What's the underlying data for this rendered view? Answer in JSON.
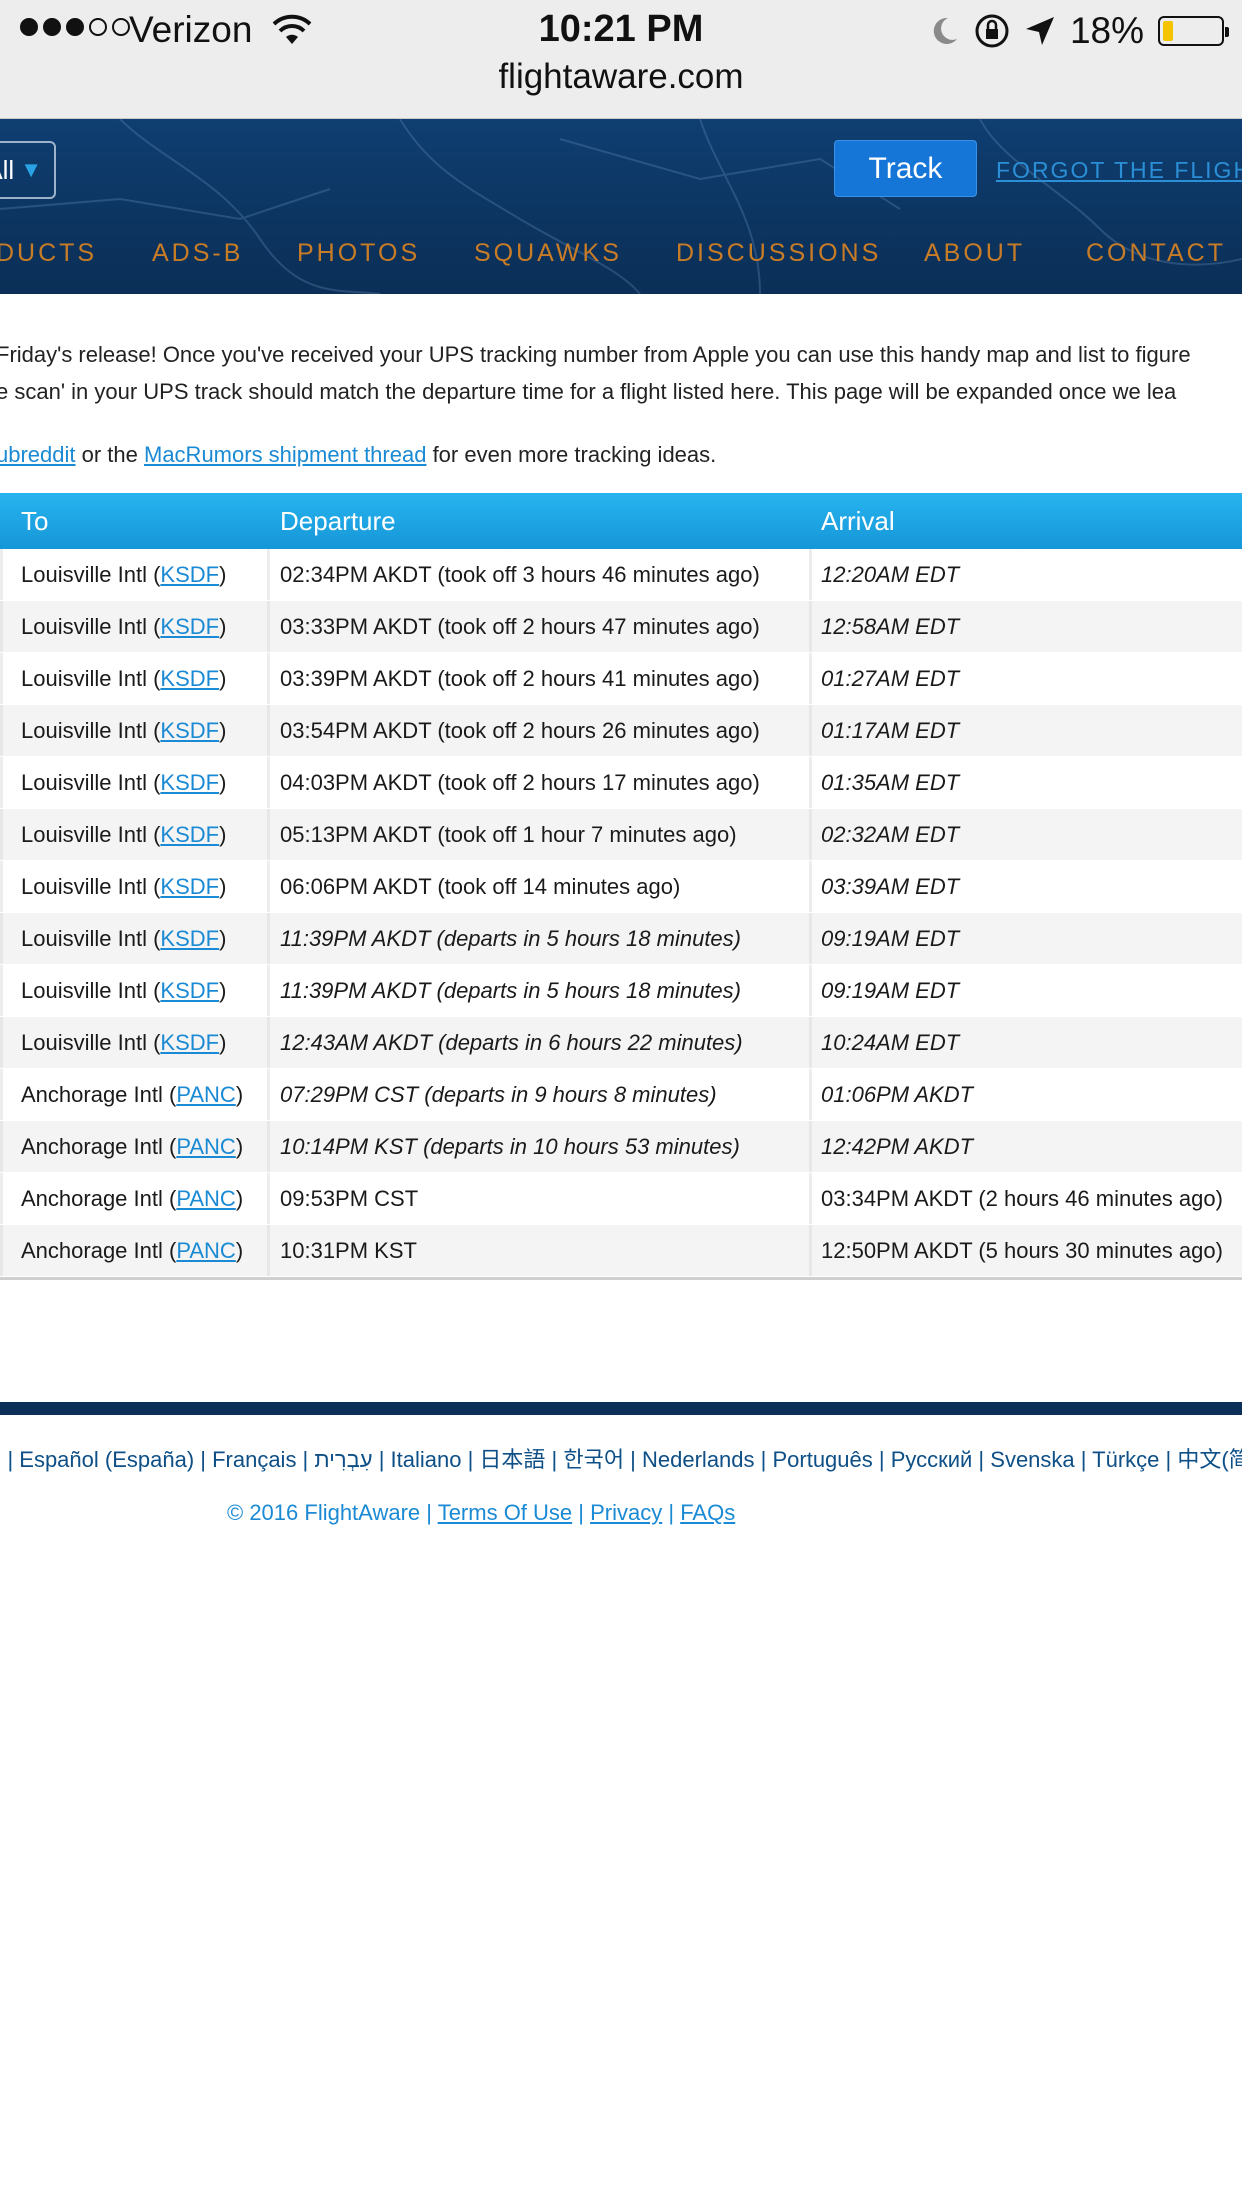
{
  "status_bar": {
    "carrier": "Verizon",
    "time": "10:21 PM",
    "battery": "18%",
    "battery_level": 0.18,
    "signal_bars": 3,
    "signal_total": 5
  },
  "browser": {
    "url": "flightaware.com"
  },
  "header": {
    "select_label": "All",
    "track_button": "Track",
    "forgot_link": "FORGOT THE FLIGHT",
    "nav": [
      "DUCTS",
      "ADS-B",
      "PHOTOS",
      "SQUAWKS",
      "DISCUSSIONS",
      "ABOUT",
      "CONTACT"
    ]
  },
  "intro": {
    "line1": "Friday's release! Once you've received your UPS tracking number from Apple you can use this handy map and list to figure",
    "line2": "e scan' in your UPS track should match the departure time for a flight listed here. This page will be expanded once we lea",
    "line3_link1": "ubreddit",
    "line3_mid": " or the ",
    "line3_link2": "MacRumors shipment thread",
    "line3_end": " for even more tracking ideas."
  },
  "table": {
    "headers": {
      "to": "To",
      "departure": "Departure",
      "arrival": "Arrival"
    },
    "rows": [
      {
        "to_name": "Louisville Intl (",
        "to_code": "KSDF",
        "to_close": ")",
        "departure": "02:34PM AKDT (took off 3 hours 46 minutes ago)",
        "dep_italic": false,
        "arrival": "12:20AM EDT",
        "arr_italic": true
      },
      {
        "to_name": "Louisville Intl (",
        "to_code": "KSDF",
        "to_close": ")",
        "departure": "03:33PM AKDT (took off 2 hours 47 minutes ago)",
        "dep_italic": false,
        "arrival": "12:58AM EDT",
        "arr_italic": true
      },
      {
        "to_name": "Louisville Intl (",
        "to_code": "KSDF",
        "to_close": ")",
        "departure": "03:39PM AKDT (took off 2 hours 41 minutes ago)",
        "dep_italic": false,
        "arrival": "01:27AM EDT",
        "arr_italic": true
      },
      {
        "to_name": "Louisville Intl (",
        "to_code": "KSDF",
        "to_close": ")",
        "departure": "03:54PM AKDT (took off 2 hours 26 minutes ago)",
        "dep_italic": false,
        "arrival": "01:17AM EDT",
        "arr_italic": true
      },
      {
        "to_name": "Louisville Intl (",
        "to_code": "KSDF",
        "to_close": ")",
        "departure": "04:03PM AKDT (took off 2 hours 17 minutes ago)",
        "dep_italic": false,
        "arrival": "01:35AM EDT",
        "arr_italic": true
      },
      {
        "to_name": "Louisville Intl (",
        "to_code": "KSDF",
        "to_close": ")",
        "departure": "05:13PM AKDT (took off 1 hour 7 minutes ago)",
        "dep_italic": false,
        "arrival": "02:32AM EDT",
        "arr_italic": true
      },
      {
        "to_name": "Louisville Intl (",
        "to_code": "KSDF",
        "to_close": ")",
        "departure": "06:06PM AKDT (took off 14 minutes ago)",
        "dep_italic": false,
        "arrival": "03:39AM EDT",
        "arr_italic": true
      },
      {
        "to_name": "Louisville Intl (",
        "to_code": "KSDF",
        "to_close": ")",
        "departure": "11:39PM AKDT (departs in 5 hours 18 minutes)",
        "dep_italic": true,
        "arrival": "09:19AM EDT",
        "arr_italic": true
      },
      {
        "to_name": "Louisville Intl (",
        "to_code": "KSDF",
        "to_close": ")",
        "departure": "11:39PM AKDT (departs in 5 hours 18 minutes)",
        "dep_italic": true,
        "arrival": "09:19AM EDT",
        "arr_italic": true
      },
      {
        "to_name": "Louisville Intl (",
        "to_code": "KSDF",
        "to_close": ")",
        "departure": "12:43AM AKDT (departs in 6 hours 22 minutes)",
        "dep_italic": true,
        "arrival": "10:24AM EDT",
        "arr_italic": true
      },
      {
        "to_name": "Anchorage Intl (",
        "to_code": "PANC",
        "to_close": ")",
        "departure": "07:29PM CST (departs in 9 hours 8 minutes)",
        "dep_italic": true,
        "arrival": "01:06PM AKDT",
        "arr_italic": true
      },
      {
        "to_name": "Anchorage Intl (",
        "to_code": "PANC",
        "to_close": ")",
        "departure": "10:14PM KST (departs in 10 hours 53 minutes)",
        "dep_italic": true,
        "arrival": "12:42PM AKDT",
        "arr_italic": true
      },
      {
        "to_name": "Anchorage Intl (",
        "to_code": "PANC",
        "to_close": ")",
        "departure": "09:53PM CST",
        "dep_italic": false,
        "arrival": "03:34PM AKDT (2 hours 46 minutes ago)",
        "arr_italic": false
      },
      {
        "to_name": "Anchorage Intl (",
        "to_code": "PANC",
        "to_close": ")",
        "departure": "10:31PM KST",
        "dep_italic": false,
        "arrival": "12:50PM AKDT (5 hours 30 minutes ago)",
        "arr_italic": false
      }
    ]
  },
  "footer": {
    "languages": ") | Español (España) | Français | עִבְרִית | Italiano | 日本語 | 한국어 | Nederlands | Português | Русский | Svenska | Türkçe | 中文(简体)",
    "copyright": "© 2016 FlightAware | ",
    "terms": "Terms Of Use",
    "sep": " | ",
    "privacy": "Privacy",
    "faqs": "FAQs"
  },
  "colors": {
    "header_bg": "#0c3561",
    "nav_text": "#c97c26",
    "track_button": "#1576d8",
    "table_header": "#1aa3e3",
    "link": "#1a8ad4",
    "battery_fill": "#f5c400"
  }
}
